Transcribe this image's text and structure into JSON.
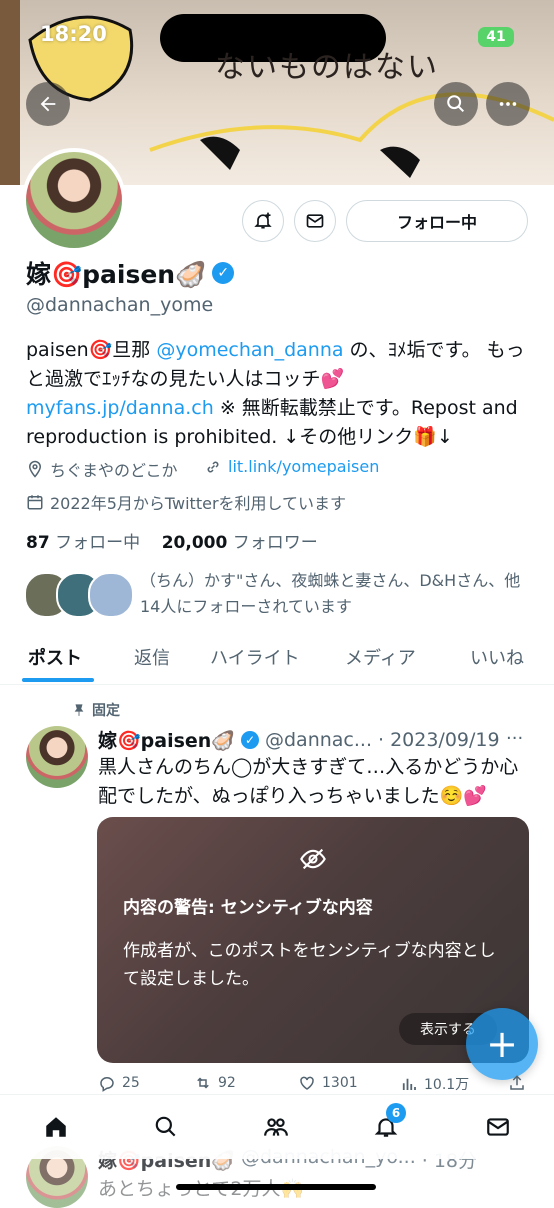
{
  "status_bar": {
    "time": "18:20",
    "battery": "41"
  },
  "banner": {
    "text": "ないものはない"
  },
  "header": {
    "back_icon": "back-arrow-icon",
    "search_icon": "search-icon",
    "more_icon": "more-icon"
  },
  "profile": {
    "follow_label": "フォロー中",
    "name": "嫁🎯paisen🦪",
    "handle": "@dannachan_yome",
    "bio": {
      "part1": "paisen🎯旦那",
      "mention": "@yomechan_danna",
      "part2": "の、ﾖﾒ垢です。 もっと過激でｴｯﾁなの見たい人はコッチ💕",
      "link": "myfans.jp/danna.ch",
      "part3": "※ 無断転載禁止です。Repost and reproduction is prohibited. ↓その他リンク🎁↓"
    },
    "location": "ちぐまやのどこか",
    "website": "lit.link/yomepaisen",
    "joined": "2022年5月からTwitterを利用しています",
    "following_count": "87",
    "following_label": "フォロー中",
    "followers_count": "20,000",
    "followers_label": "フォロワー",
    "known_followers": "（ちん）かす\"さん、夜蜘蛛と妻さん、D&Hさん、他14人にフォローされています"
  },
  "tabs": [
    "ポスト",
    "返信",
    "ハイライト",
    "メディア",
    "いいね"
  ],
  "pinned_post": {
    "pinned_label": "固定",
    "name": "嫁🎯paisen🦪",
    "handle": "@dannac...",
    "date": "· 2023/09/19",
    "text": "黒人さんのちん◯が大きすぎて…入るかどうか心配でしたが、ぬっぽり入っちゃいました☺️💕",
    "warning_title": "内容の警告: センシティブな内容",
    "warning_body": "作成者が、このポストをセンシティブな内容として設定しました。",
    "show_label": "表示する",
    "replies": "25",
    "reposts": "92",
    "likes": "1301",
    "views": "10.1万"
  },
  "bottom_nav": {
    "notifications_badge": "6"
  },
  "next_post": {
    "name": "嫁🎯paisen🦪",
    "handle": "@dannachan_yo...",
    "time": "· 18分",
    "text": "あとちょっとで2万人🙌"
  },
  "colors": {
    "accent": "#1d9bf0",
    "text": "#0f1419",
    "muted": "#536471"
  }
}
